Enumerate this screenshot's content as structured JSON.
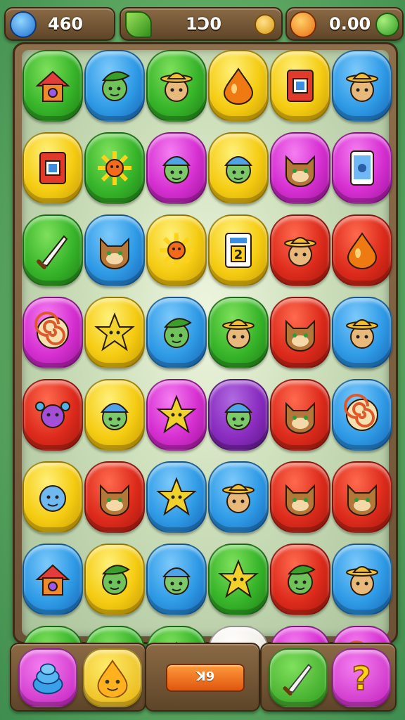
{
  "hud": {
    "left": {
      "value": "460",
      "icon": "blue-gem-icon"
    },
    "center": {
      "value": "1Ↄ0",
      "icon": "leaf-icon",
      "end_icon": "coin-icon"
    },
    "right": {
      "value": "0.00",
      "icon": "orange-drop-icon",
      "end_icon": "clover-icon"
    }
  },
  "board": {
    "rows": 8,
    "cols": 6,
    "tiles": [
      [
        "green:house",
        "blue:leaf-face",
        "green:hat-face",
        "yellow:drop",
        "yellow:box",
        "blue:hat-face"
      ],
      [
        "yellow:box",
        "green:sun",
        "pink:cap-face",
        "yellow:cap-face",
        "pink:cat-face",
        "pink:phone"
      ],
      [
        "green:knife",
        "blue:cat-face",
        "yellow:sun",
        "yellow:card-2",
        "red:hat-face",
        "red:drop"
      ],
      [
        "pink:swirl",
        "yellow:star",
        "blue:leaf-face",
        "green:hat-face",
        "red:cat-face",
        "blue:hat-face"
      ],
      [
        "red:flower-face",
        "yellow:cap-face",
        "pink:star",
        "purple:cap-face",
        "red:cat-face",
        "blue:swirl"
      ],
      [
        "yellow:face",
        "red:cat-face",
        "blue:star",
        "blue:hat-face",
        "red:cat-face",
        "red:cat-face"
      ],
      [
        "blue:house",
        "yellow:leaf-face",
        "blue:cap-face",
        "green:star",
        "red:leaf-face",
        "blue:hat-face"
      ],
      [
        "green:gem-box",
        "green:hat-face",
        "green:star",
        "white:drop",
        "pink:phone",
        "pink:swirl"
      ]
    ],
    "card_number": "2"
  },
  "bottom": {
    "left_items": [
      "pink:hive",
      "yellow:face"
    ],
    "center_button": "ꓘ9",
    "right_items": [
      "green:knife",
      "pink:question"
    ],
    "question_mark": "?"
  },
  "colors": {
    "green": "#37b52a",
    "blue": "#2f9be6",
    "yellow": "#f5cc12",
    "pink": "#d62fd1",
    "red": "#dd2b1c",
    "purple": "#8a2cc0",
    "white": "#f4f1ea"
  }
}
